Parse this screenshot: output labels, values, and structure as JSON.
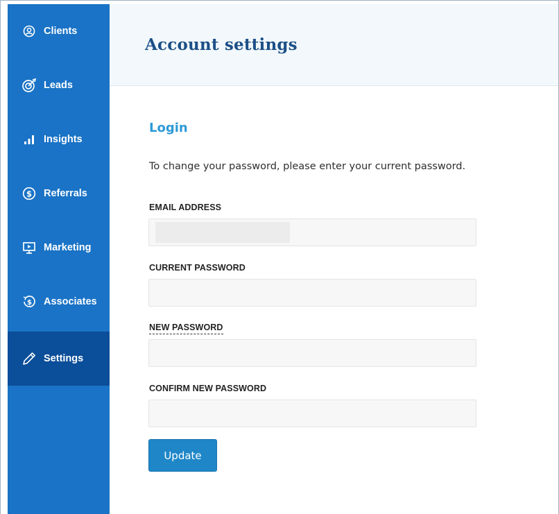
{
  "sidebar": {
    "items": [
      {
        "label": "Clients",
        "icon": "user-circle-icon"
      },
      {
        "label": "Leads",
        "icon": "target-icon"
      },
      {
        "label": "Insights",
        "icon": "bar-chart-icon"
      },
      {
        "label": "Referrals",
        "icon": "dollar-circle-icon"
      },
      {
        "label": "Marketing",
        "icon": "presentation-icon"
      },
      {
        "label": "Associates",
        "icon": "dollar-cycle-icon"
      },
      {
        "label": "Settings",
        "icon": "pencil-icon",
        "active": true
      }
    ],
    "bg_color": "#1a73c6",
    "active_color": "#0b4e9a"
  },
  "header": {
    "title": "Account settings"
  },
  "login": {
    "section_title": "Login",
    "intro": "To change your password, please enter your current password.",
    "fields": {
      "email": {
        "label": "EMAIL ADDRESS",
        "value": ""
      },
      "current_password": {
        "label": "CURRENT PASSWORD",
        "value": ""
      },
      "new_password": {
        "label": "NEW PASSWORD",
        "value": ""
      },
      "confirm_password": {
        "label": "CONFIRM NEW PASSWORD",
        "value": ""
      }
    },
    "submit_label": "Update"
  },
  "colors": {
    "accent": "#2c9ad6",
    "title": "#1c4f86",
    "button": "#1f86c8"
  }
}
